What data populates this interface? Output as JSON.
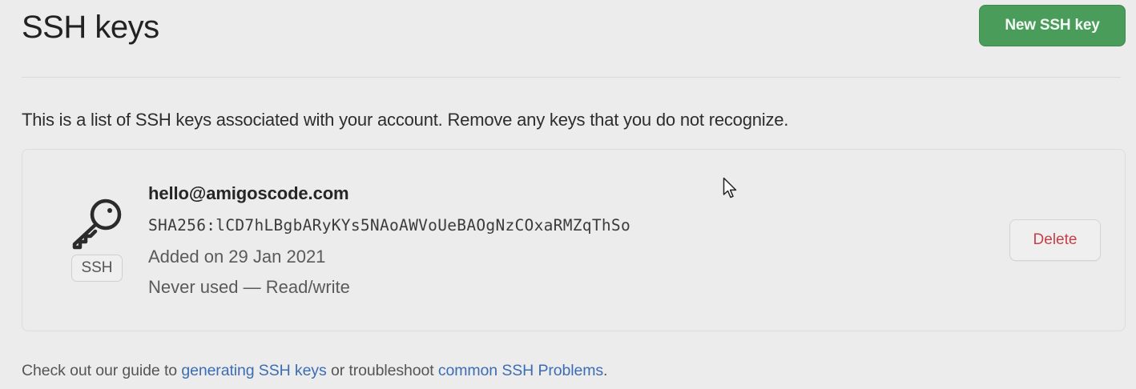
{
  "page": {
    "title": "SSH keys",
    "new_key_button": "New SSH key",
    "intro": "This is a list of SSH keys associated with your account. Remove any keys that you do not recognize."
  },
  "key": {
    "badge": "SSH",
    "title": "hello@amigoscode.com",
    "fingerprint": "SHA256:lCD7hLBgbARyKYs5NAoAWVoUeBAOgNzCOxaRMZqThSo",
    "added": "Added on 29 Jan 2021",
    "usage": "Never used — Read/write",
    "delete_label": "Delete",
    "icon": "key-icon"
  },
  "footer": {
    "prefix": "Check out our guide to ",
    "link1": "generating SSH keys",
    "middle": " or troubleshoot ",
    "link2": "common SSH Problems",
    "suffix": "."
  },
  "colors": {
    "primary_button": "#4a9c5a",
    "danger_text": "#c4404a",
    "link": "#3c6db4"
  }
}
